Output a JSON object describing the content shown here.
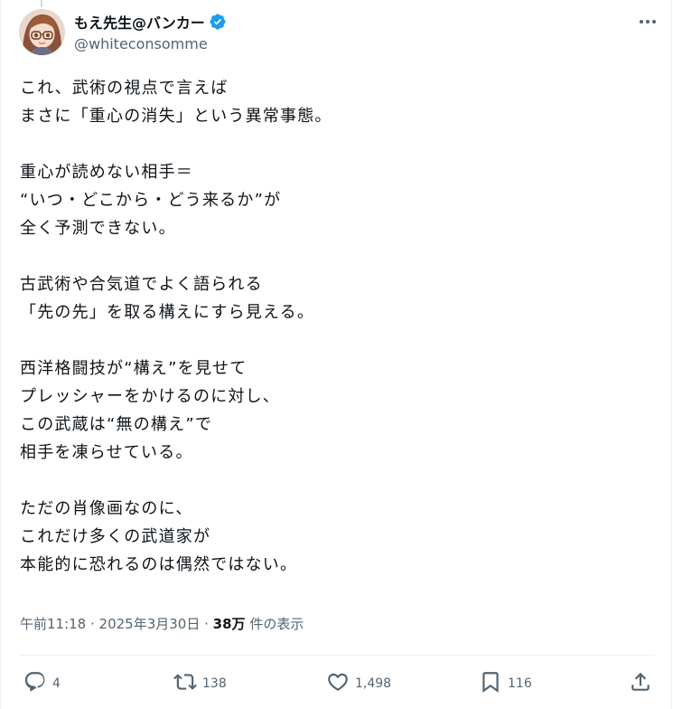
{
  "author": {
    "display_name": "もえ先生@バンカー",
    "handle": "@whiteconsomme",
    "verified_color": "#1d9bf0"
  },
  "tweet": {
    "lines": [
      "これ、武術の視点で言えば",
      "まさに「重心の消失」という異常事態。",
      "",
      "重心が読めない相手＝",
      "“いつ・どこから・どう来るか”が",
      "全く予測できない。",
      "",
      "古武術や合気道でよく語られる",
      "「先の先」を取る構えにすら見える。",
      "",
      "西洋格闘技が“構え”を見せて",
      "プレッシャーをかけるのに対し、",
      "この武蔵は“無の構え”で",
      "相手を凍らせている。",
      "",
      "ただの肖像画なのに、",
      "これだけ多くの武道家が",
      "本能的に恐れるのは偶然ではない。"
    ]
  },
  "meta": {
    "time": "午前11:18",
    "sep1": " · ",
    "date": "2025年3月30日",
    "sep2": " · ",
    "views": "38万",
    "views_suffix": " 件の表示"
  },
  "actions": {
    "replies": "4",
    "reposts": "138",
    "likes": "1,498",
    "bookmarks": "116"
  },
  "icons": {
    "more": "more-horizontal-icon",
    "reply": "reply-icon",
    "repost": "repost-icon",
    "like": "heart-icon",
    "bookmark": "bookmark-icon",
    "share": "share-icon"
  }
}
